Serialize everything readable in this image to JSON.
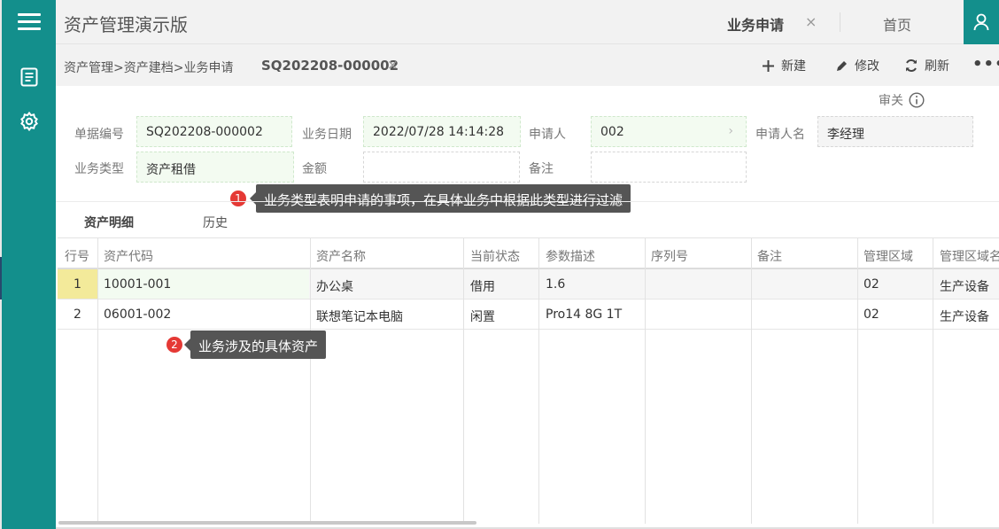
{
  "app": {
    "title": "资产管理演示版"
  },
  "tabs": [
    {
      "label": "业务申请",
      "close": "×"
    },
    {
      "label": "首页"
    }
  ],
  "breadcrumb": {
    "path": "资产管理>资产建档>业务申请",
    "doc_tab": "SQ202208-000002",
    "doc_close": "×"
  },
  "toolbar": {
    "new_label": "新建",
    "edit_label": "修改",
    "refresh_label": "刷新",
    "more_label": "•••"
  },
  "audit": {
    "label": "审关"
  },
  "form": {
    "doc_no_label": "单据编号",
    "doc_no": "SQ202208-000002",
    "biz_date_label": "业务日期",
    "biz_date": "2022/07/28 14:14:28",
    "applicant_label": "申请人",
    "applicant": "002",
    "applicant_arrow": "›",
    "applicant_name_label": "申请人名",
    "applicant_name": "李经理",
    "biz_type_label": "业务类型",
    "biz_type": "资产租借",
    "amount_label": "金额",
    "amount": "",
    "remark_label": "备注",
    "remark": ""
  },
  "annotations": [
    {
      "num": "1",
      "text": "业务类型表明申请的事项，在具体业务中根据此类型进行过滤"
    },
    {
      "num": "2",
      "text": "业务涉及的具体资产"
    }
  ],
  "subtabs": [
    "资产明细",
    "历史"
  ],
  "table": {
    "columns": [
      "行号",
      "资产代码",
      "资产名称",
      "当前状态",
      "参数描述",
      "序列号",
      "备注",
      "管理区域",
      "管理区域名"
    ],
    "rows": [
      {
        "no": "1",
        "code": "10001-001",
        "name": "办公桌",
        "status": "借用",
        "params": "1.6",
        "serial": "",
        "remark": "",
        "area": "02",
        "area_name": "生产设备"
      },
      {
        "no": "2",
        "code": "06001-002",
        "name": "联想笔记本电脑",
        "status": "闲置",
        "params": "Pro14 8G 1T",
        "serial": "",
        "remark": "",
        "area": "02",
        "area_name": "生产设备"
      }
    ]
  },
  "colors": {
    "sidebar": "#138f8c",
    "green_field": "#f3fbf1",
    "badge": "#e53935",
    "tooltip": "#555555",
    "row_highlight": "#f3ea9a"
  },
  "icons": [
    "menu-icon",
    "document-icon",
    "gear-icon",
    "user-icon",
    "plus-icon",
    "pencil-icon",
    "refresh-icon",
    "more-icon",
    "info-icon",
    "close-icon"
  ]
}
